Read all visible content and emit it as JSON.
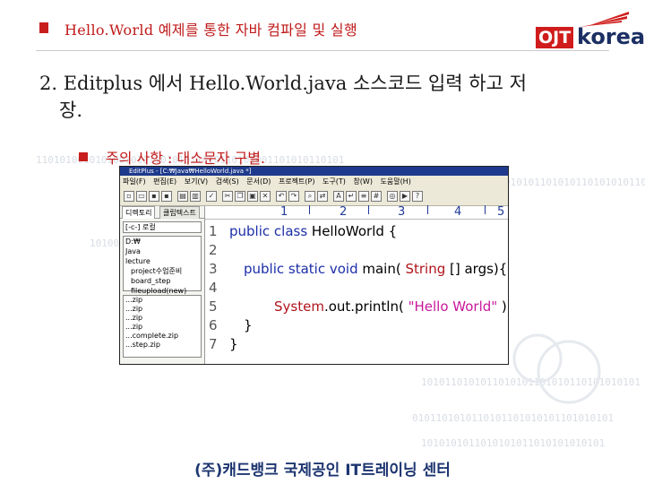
{
  "header": {
    "title": "Hello.World 예제를 통한 자바 컴파일 및 실행",
    "logo_text_1": "OJT",
    "logo_text_2": "korea"
  },
  "heading": {
    "line1": "2. Editplus 에서 Hello.World.java 소스코드 입력 하고 저",
    "line2": "장."
  },
  "note": "주의 사항 : 대소문자 구별.",
  "editor": {
    "titlebar": "EditPlus - [C:₩Java₩HelloWorld.java *]",
    "menu": [
      "파일(F)",
      "편집(E)",
      "보기(V)",
      "검색(S)",
      "문서(D)",
      "프로젝트(P)",
      "도구(T)",
      "창(W)",
      "도움말(H)"
    ],
    "dir_tabs": [
      "디렉토리",
      "클립텍스트"
    ],
    "drive": "[-c-] 로컬",
    "tree": [
      "D:₩",
      "Java",
      "lecture",
      "project수업준비",
      "board_step",
      "fileupload(new)"
    ],
    "files": [
      "...zip",
      "...zip",
      "...zip",
      "...zip",
      "...complete.zip",
      "...step.zip"
    ],
    "ruler": [
      "1",
      "2",
      "3",
      "4",
      "5"
    ],
    "line_numbers": [
      "1",
      "2",
      "3",
      "4",
      "5",
      "6",
      "7"
    ],
    "code": {
      "l1_kw": "public class",
      "l1_rest": " HelloWorld {",
      "l3_kw": "public static void",
      "l3_mid": " main( ",
      "l3_type": "String",
      "l3_rest": " [] args){",
      "l5_cls": "System",
      "l5_mid": ".out.println( ",
      "l5_str": "\"Hello World\"",
      "l5_rest": " );",
      "l6": "}",
      "l7": "}"
    }
  },
  "background_bits": [
    "1101010010101001010110101011010110101001101010110101",
    "01101001010101101010110101010110101010101101010101011001010",
    "1010010110101011010101101010101101010110101001",
    "10101101010110101001101010110101011010101101011010",
    "1010110101011010101101010110101010101",
    "0101101010110101101010101101010101",
    "1010101011010101011010101010101"
  ],
  "footer": "(주)캐드뱅크 국제공인 IT트레이닝 센터"
}
